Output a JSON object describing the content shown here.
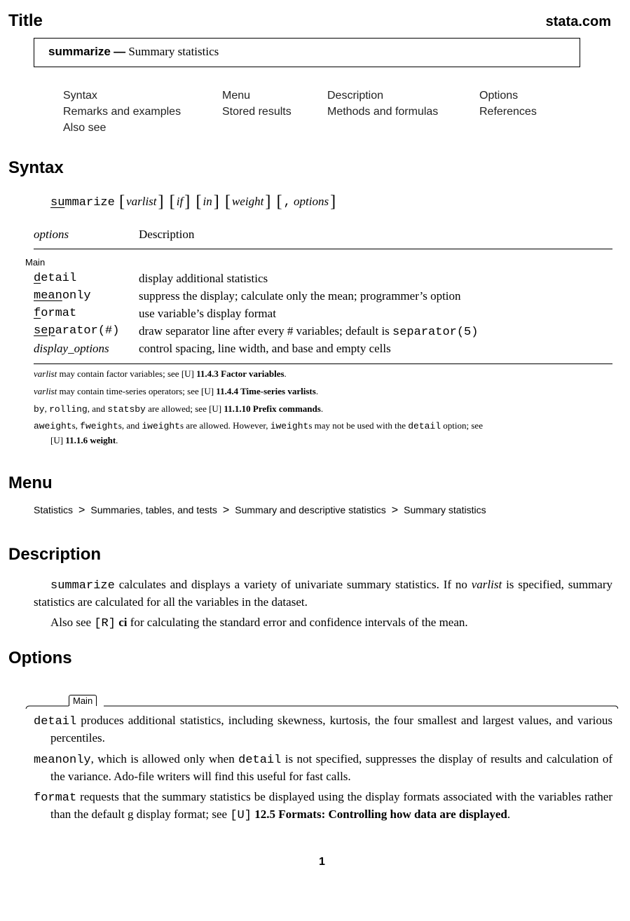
{
  "header": {
    "section_title": "Title",
    "site": "stata.com",
    "command": "summarize",
    "dash": "—",
    "command_description": "Summary statistics"
  },
  "toc": [
    {
      "label": "Syntax"
    },
    {
      "label": "Menu"
    },
    {
      "label": "Description"
    },
    {
      "label": "Options"
    },
    {
      "label": "Remarks and examples"
    },
    {
      "label": "Stored results"
    },
    {
      "label": "Methods and formulas"
    },
    {
      "label": "References"
    },
    {
      "label": "Also see"
    }
  ],
  "syntax": {
    "heading": "Syntax",
    "command_underlined": "su",
    "command_rest": "mmarize",
    "args": [
      "varlist",
      "if",
      "in",
      "weight"
    ],
    "options_comma": ",",
    "options_arg": "options",
    "table_header_options": "options",
    "table_header_description": "Description",
    "group_label": "Main",
    "options": [
      {
        "abbrev": "d",
        "rest": "etail",
        "description": "display additional statistics"
      },
      {
        "abbrev": "mean",
        "rest": "only",
        "description": "suppress the display; calculate only the mean; programmer’s option"
      },
      {
        "abbrev": "f",
        "rest": "ormat",
        "description": "use variable’s display format"
      },
      {
        "abbrev": "sep",
        "rest": "arator(#)",
        "description_pre": "draw separator line after every # variables; default is ",
        "description_code": "separator(5)"
      },
      {
        "name_italic": "display_options",
        "description": "control spacing, line width, and base and empty cells"
      }
    ],
    "notes": [
      {
        "italic": "varlist",
        "text": " may contain factor variables; see ",
        "ref": "[U]",
        "bold": " 11.4.3 Factor variables",
        "end": "."
      },
      {
        "italic": "varlist",
        "text": " may contain time-series operators; see ",
        "ref": "[U]",
        "bold": " 11.4.4 Time-series varlists",
        "end": "."
      },
      {
        "code1": "by",
        "t1": ", ",
        "code2": "rolling",
        "t2": ", and ",
        "code3": "statsby",
        "text": " are allowed; see ",
        "ref": "[U]",
        "bold": " 11.1.10 Prefix commands",
        "end": "."
      },
      {
        "code1": "aweight",
        "t1": "s, ",
        "code2": "fweight",
        "t2": "s, and ",
        "code3": "iweight",
        "t3": "s are allowed. However, ",
        "code4": "iweight",
        "t4": "s may not be used with the ",
        "code5": "detail",
        "t5": " option; see",
        "ref": "[U]",
        "bold": " 11.1.6 weight",
        "end": "."
      }
    ]
  },
  "menu": {
    "heading": "Menu",
    "path": [
      "Statistics",
      "Summaries, tables, and tests",
      "Summary and descriptive statistics",
      "Summary statistics"
    ],
    "separator": ">"
  },
  "description": {
    "heading": "Description",
    "p1_code": "summarize",
    "p1_text": " calculates and displays a variety of univariate summary statistics. If no ",
    "p1_italic": "varlist",
    "p1_end": " is specified, summary statistics are calculated for all the variables in the dataset.",
    "p2_pre": "Also see ",
    "p2_ref": "[R]",
    "p2_bold": " ci",
    "p2_end": " for calculating the standard error and confidence intervals of the mean."
  },
  "options": {
    "heading": "Options",
    "tab_label": "Main",
    "items": [
      {
        "code": "detail",
        "text": " produces additional statistics, including skewness, kurtosis, the four smallest and largest values, and various percentiles."
      },
      {
        "code": "meanonly",
        "text1": ", which is allowed only when ",
        "code2": "detail",
        "text2": " is not specified, suppresses the display of results and calculation of the variance. Ado-file writers will find this useful for fast calls."
      },
      {
        "code": "format",
        "text": " requests that the summary statistics be displayed using the display formats associated with the variables rather than the default g display format; see ",
        "ref": "[U]",
        "bold": " 12.5 Formats: Controlling how data are displayed",
        "end": "."
      }
    ]
  },
  "footer": {
    "page_number": "1"
  }
}
